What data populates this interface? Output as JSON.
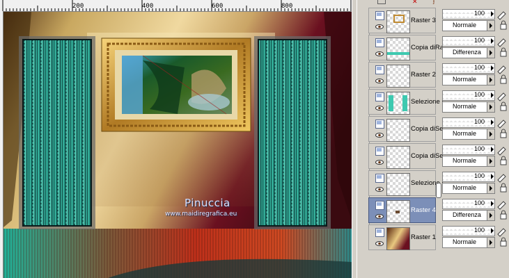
{
  "ruler": {
    "labels": [
      "200",
      "400",
      "600",
      "800"
    ]
  },
  "canvas": {
    "watermark": "Pinuccia",
    "watermark_url": "www.maidiregrafica.eu"
  },
  "layers": [
    {
      "name": "Raster 3",
      "opacity": "100",
      "blend": "Normale",
      "selected": false,
      "thumb": "frame-icon"
    },
    {
      "name": "Copia diRa",
      "opacity": "100",
      "blend": "Differenza",
      "selected": false,
      "thumb": "teal-stripe"
    },
    {
      "name": "Raster 2",
      "opacity": "100",
      "blend": "Normale",
      "selected": false,
      "thumb": "empty"
    },
    {
      "name": "Selezione i",
      "opacity": "100",
      "blend": "Normale",
      "selected": false,
      "thumb": "teal-panels"
    },
    {
      "name": "Copia diSe",
      "opacity": "100",
      "blend": "Normale",
      "selected": false,
      "thumb": "empty"
    },
    {
      "name": "Copia diSe",
      "opacity": "100",
      "blend": "Normale",
      "selected": false,
      "thumb": "empty"
    },
    {
      "name": "Selezione i",
      "opacity": "100",
      "blend": "Normale",
      "selected": false,
      "thumb": "empty"
    },
    {
      "name": "Raster 4",
      "opacity": "100",
      "blend": "Differenza",
      "selected": true,
      "thumb": "small-dot"
    },
    {
      "name": "Raster 1",
      "opacity": "100",
      "blend": "Normale",
      "selected": false,
      "thumb": "gradient"
    }
  ],
  "colors": {
    "selected_row": "#7c8fb8",
    "panel_bg": "#d4d0c8",
    "teal": "#3ec9b0"
  }
}
